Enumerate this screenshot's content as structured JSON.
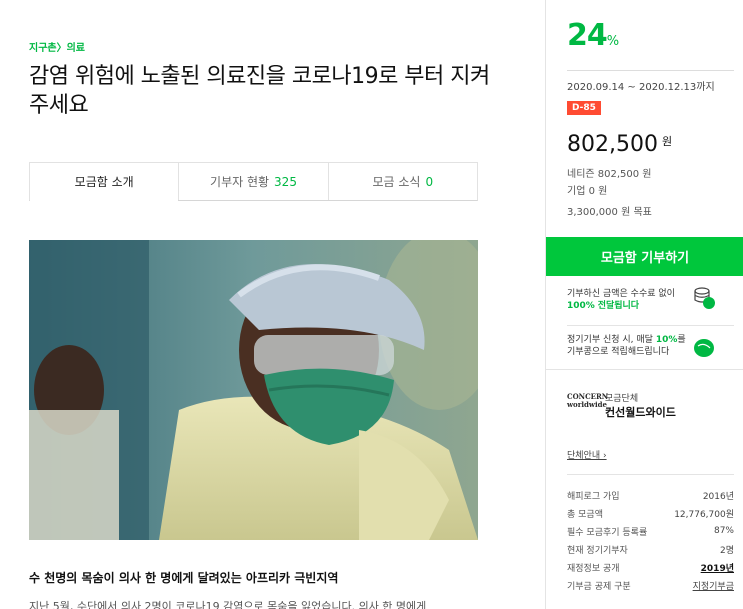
{
  "breadcrumb": "지구촌〉의료",
  "title": "감염 위험에 노출된 의료진을 코로나19로 부터 지켜주세요",
  "tabs": [
    {
      "label": "모금함 소개",
      "count": ""
    },
    {
      "label": "기부자 현황",
      "count": "325"
    },
    {
      "label": "모금 소식",
      "count": "0"
    }
  ],
  "section_heading": "수 천명의 목숨이 의사 한 명에게 달려있는 아프리카 극빈지역",
  "body_text": "지난 5월, 수단에서 의사 2명이 코로나19 감염으로 목숨을 잃었습니다. 의사 한 명에게",
  "sidebar": {
    "percent": "24",
    "percent_unit": "%",
    "period": "2020.09.14 ~ 2020.12.13까지",
    "dday": "D-85",
    "amount": "802,500",
    "amount_unit": "원",
    "netizen": "네티즌 802,500 원",
    "company": "기업 0 원",
    "goal": "3,300,000 원 목표",
    "cta_label": "모금함 기부하기",
    "info1_pre": "기부하신 금액은 수수료 없이",
    "info1_strong": "100%",
    "info1_post": "전달됩니다",
    "info2_pre": "정기기부 신청 시, 매달",
    "info2_strong": "10%",
    "info2_post": "를 기부콩으로 적립해드립니다",
    "org_logo": "CONCERN worldwide",
    "org_label": "모금단체",
    "org_name": "컨선월드와이드",
    "org_link": "단체안내 ›",
    "stats": [
      {
        "label": "해피로그 가입",
        "value": "2016년"
      },
      {
        "label": "총 모금액",
        "value": "12,776,700원"
      },
      {
        "label": "필수 모금후기 등록률",
        "value": "87%"
      },
      {
        "label": "현재 정기기부자",
        "value": "2명"
      },
      {
        "label": "재정정보 공개",
        "value": "2019년"
      },
      {
        "label": "기부금 공제 구분",
        "value": "지정기부금"
      }
    ]
  },
  "colors": {
    "accent": "#00b843",
    "cta": "#00c73c",
    "dday": "#ff4b32"
  }
}
